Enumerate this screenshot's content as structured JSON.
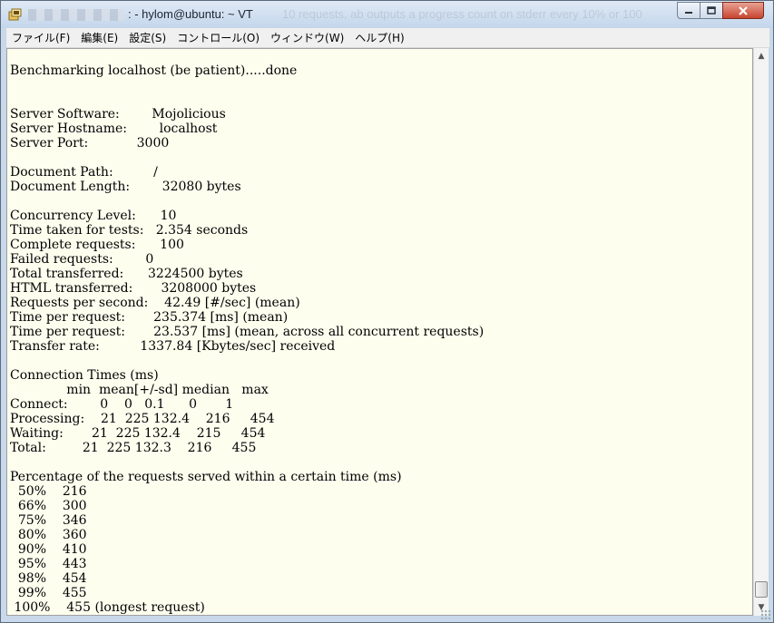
{
  "window": {
    "title": ": - hylom@ubuntu: ~ VT",
    "ghost_text": "10 requests, ab outputs a progress count on stderr every 10% or 100",
    "icons": {
      "app": "tera-term-app-icon",
      "minimize": "minimize-icon",
      "maximize": "maximize-icon",
      "close": "close-icon"
    }
  },
  "menu": [
    "ファイル(F)",
    "編集(E)",
    "設定(S)",
    "コントロール(O)",
    "ウィンドウ(W)",
    "ヘルプ(H)"
  ],
  "terminal": {
    "lines": [
      "",
      "Benchmarking localhost (be patient).....done",
      "",
      "",
      "Server Software:        Mojolicious",
      "Server Hostname:        localhost",
      "Server Port:            3000",
      "",
      "Document Path:          /",
      "Document Length:        32080 bytes",
      "",
      "Concurrency Level:      10",
      "Time taken for tests:   2.354 seconds",
      "Complete requests:      100",
      "Failed requests:        0",
      "Total transferred:      3224500 bytes",
      "HTML transferred:       3208000 bytes",
      "Requests per second:    42.49 [#/sec] (mean)",
      "Time per request:       235.374 [ms] (mean)",
      "Time per request:       23.537 [ms] (mean, across all concurrent requests)",
      "Transfer rate:          1337.84 [Kbytes/sec] received",
      "",
      "Connection Times (ms)",
      "              min  mean[+/-sd] median   max",
      "Connect:        0    0   0.1      0       1",
      "Processing:    21  225 132.4    216     454",
      "Waiting:       21  225 132.4    215     454",
      "Total:         21  225 132.3    216     455",
      "",
      "Percentage of the requests served within a certain time (ms)",
      "  50%    216",
      "  66%    300",
      "  75%    346",
      "  80%    360",
      "  90%    410",
      "  95%    443",
      "  98%    454",
      "  99%    455",
      " 100%    455 (longest request)"
    ]
  },
  "scrollbar": {
    "up_arrow": "▲",
    "down_arrow": "▼"
  }
}
